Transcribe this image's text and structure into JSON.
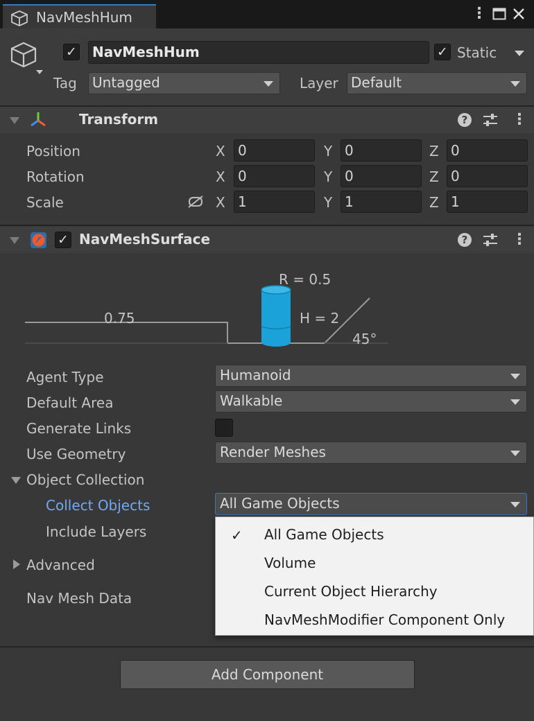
{
  "window": {
    "tab_title": "NavMeshHum",
    "menu_icon": "kebab-menu-icon",
    "maximize_icon": "maximize-icon",
    "close_icon": "close-icon"
  },
  "object": {
    "name": "NavMeshHum",
    "active": true,
    "static_label": "Static",
    "static": true,
    "tag_label": "Tag",
    "tag_value": "Untagged",
    "layer_label": "Layer",
    "layer_value": "Default"
  },
  "transform": {
    "title": "Transform",
    "rows": [
      {
        "label": "Position",
        "x": "0",
        "y": "0",
        "z": "0"
      },
      {
        "label": "Rotation",
        "x": "0",
        "y": "0",
        "z": "0"
      },
      {
        "label": "Scale",
        "x": "1",
        "y": "1",
        "z": "1"
      }
    ],
    "axis_x": "X",
    "axis_y": "Y",
    "axis_z": "Z"
  },
  "navmesh_surface": {
    "title": "NavMeshSurface",
    "enabled": true,
    "diagram": {
      "radius": "R = 0.5",
      "height": "H = 2",
      "step": "0.75",
      "slope": "45°"
    },
    "agent_type_label": "Agent Type",
    "agent_type_value": "Humanoid",
    "default_area_label": "Default Area",
    "default_area_value": "Walkable",
    "generate_links_label": "Generate Links",
    "generate_links": false,
    "use_geometry_label": "Use Geometry",
    "use_geometry_value": "Render Meshes",
    "object_collection_label": "Object Collection",
    "collect_objects_label": "Collect Objects",
    "collect_objects_value": "All Game Objects",
    "include_layers_label": "Include Layers",
    "advanced_label": "Advanced",
    "nav_mesh_data_label": "Nav Mesh Data"
  },
  "popup": {
    "items": [
      {
        "label": "All Game Objects",
        "selected": true
      },
      {
        "label": "Volume",
        "selected": false
      },
      {
        "label": "Current Object Hierarchy",
        "selected": false
      },
      {
        "label": "NavMeshModifier Component Only",
        "selected": false
      }
    ],
    "check_glyph": "✓"
  },
  "add_component_label": "Add Component",
  "colors": {
    "accent": "#3a79bb",
    "link_label": "#6fa9f5",
    "cylinder": "#1ba2d8"
  }
}
